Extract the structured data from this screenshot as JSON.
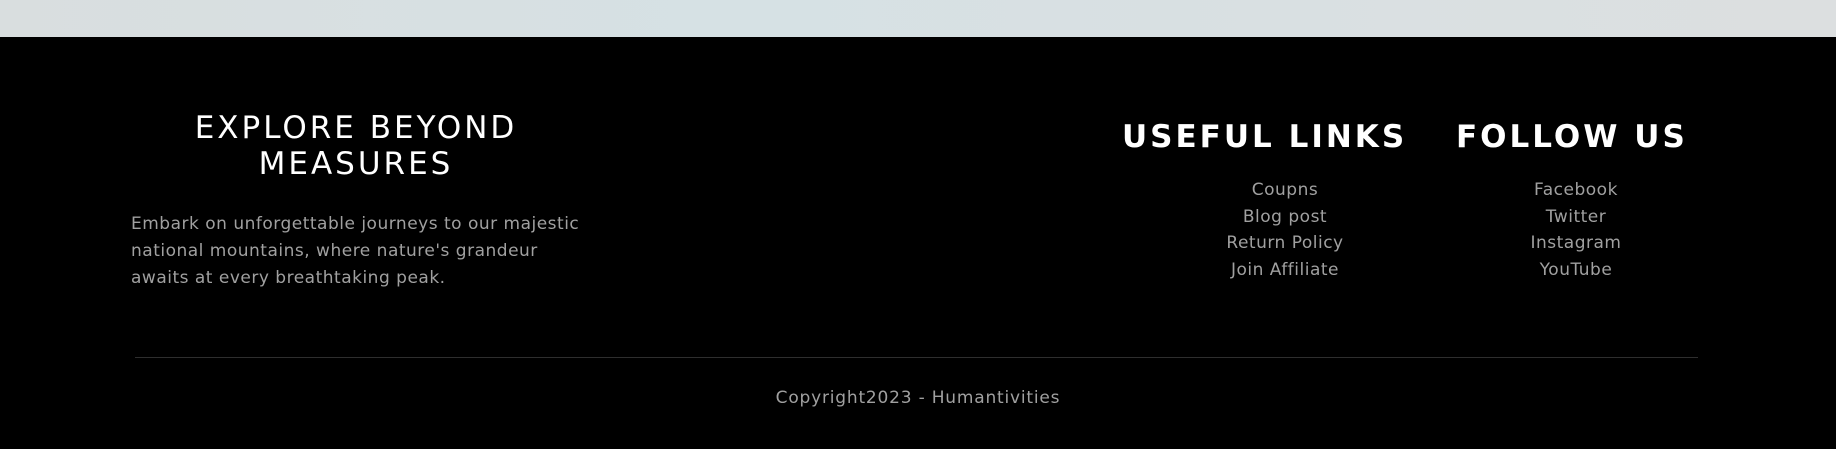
{
  "brand": {
    "title": "EXPLORE BEYOND MEASURES",
    "description": "Embark on unforgettable journeys to our majestic national mountains, where nature's grandeur awaits at every breathtaking peak."
  },
  "useful_links": {
    "title": "USEFUL LINKS",
    "items": [
      {
        "label": "Coupns"
      },
      {
        "label": "Blog post"
      },
      {
        "label": "Return Policy"
      },
      {
        "label": "Join Affiliate"
      }
    ]
  },
  "follow_us": {
    "title": "FOLLOW US",
    "items": [
      {
        "label": "Facebook"
      },
      {
        "label": "Twitter"
      },
      {
        "label": "Instagram"
      },
      {
        "label": "YouTube"
      }
    ]
  },
  "footer": {
    "copyright": "Copyright2023 - Humantivities"
  },
  "colors": {
    "background": "#000000",
    "heading": "#ffffff",
    "text": "#a0a0a0",
    "divider": "#2e2e2e",
    "top_strip": "#d8e0e2"
  }
}
